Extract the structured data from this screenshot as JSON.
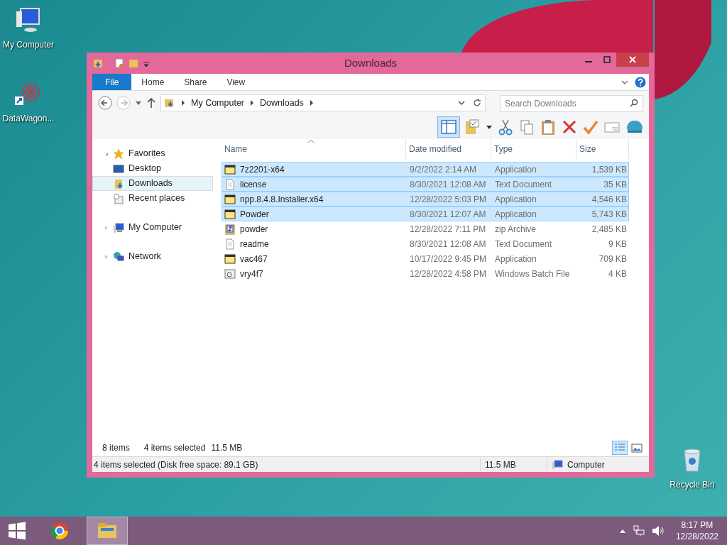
{
  "desktop_icons": [
    {
      "label": "My Computer",
      "kind": "computer"
    },
    {
      "label": "DataWagon...",
      "kind": "shortcut"
    },
    {
      "label": "Recycle Bin",
      "kind": "recycle"
    }
  ],
  "window": {
    "title": "Downloads"
  },
  "ribbon": {
    "file_label": "File",
    "tabs": [
      "Home",
      "Share",
      "View"
    ]
  },
  "address": {
    "crumbs": [
      "My Computer",
      "Downloads"
    ],
    "search_placeholder": "Search Downloads"
  },
  "toolbar": {
    "preview_pane_on": true
  },
  "nav": [
    {
      "label": "Favorites",
      "kind": "star",
      "selected": false,
      "expanded": true,
      "children": [
        {
          "label": "Desktop",
          "kind": "desktop",
          "selected": false
        },
        {
          "label": "Downloads",
          "kind": "downloads",
          "selected": true
        },
        {
          "label": "Recent places",
          "kind": "recent",
          "selected": false
        }
      ]
    },
    {
      "label": "My Computer",
      "kind": "computer",
      "selected": false,
      "expanded": false
    },
    {
      "label": "Network",
      "kind": "network",
      "selected": false,
      "expanded": false
    }
  ],
  "columns": [
    "Name",
    "Date modified",
    "Type",
    "Size"
  ],
  "rows": [
    {
      "name": "7z2201-x64",
      "date": "9/2/2022 2:14 AM",
      "type": "Application",
      "size": "1,539 KB",
      "kind": "app",
      "selected": true
    },
    {
      "name": "license",
      "date": "8/30/2021 12:08 AM",
      "type": "Text Document",
      "size": "35 KB",
      "kind": "text",
      "selected": true
    },
    {
      "name": "npp.8.4.8.Installer.x64",
      "date": "12/28/2022 5:03 PM",
      "type": "Application",
      "size": "4,546 KB",
      "kind": "app",
      "selected": true
    },
    {
      "name": "Powder",
      "date": "8/30/2021 12:07 AM",
      "type": "Application",
      "size": "5,743 KB",
      "kind": "app",
      "selected": true
    },
    {
      "name": "powder",
      "date": "12/28/2022 7:11 PM",
      "type": "zip Archive",
      "size": "2,485 KB",
      "kind": "zip",
      "selected": false
    },
    {
      "name": "readme",
      "date": "8/30/2021 12:08 AM",
      "type": "Text Document",
      "size": "9 KB",
      "kind": "text",
      "selected": false
    },
    {
      "name": "vac467",
      "date": "10/17/2022 9:45 PM",
      "type": "Application",
      "size": "709 KB",
      "kind": "app",
      "selected": false
    },
    {
      "name": "vry4f7",
      "date": "12/28/2022 4:58 PM",
      "type": "Windows Batch File",
      "size": "4 KB",
      "kind": "batch",
      "selected": false
    }
  ],
  "footer": {
    "item_count": "8 items",
    "selection": "4 items selected",
    "selection_size": "11.5 MB",
    "views": [
      {
        "kind": "details",
        "selected": true
      },
      {
        "kind": "thumbnails",
        "selected": false
      }
    ]
  },
  "status_bar": {
    "message": "4 items selected (Disk free space: 89.1 GB)",
    "size": "11.5 MB",
    "location": "Computer"
  },
  "taskbar": {
    "apps": [
      {
        "kind": "browser",
        "active": false
      },
      {
        "kind": "explorer",
        "active": true
      }
    ],
    "time": "8:17 PM",
    "date": "12/28/2022"
  }
}
